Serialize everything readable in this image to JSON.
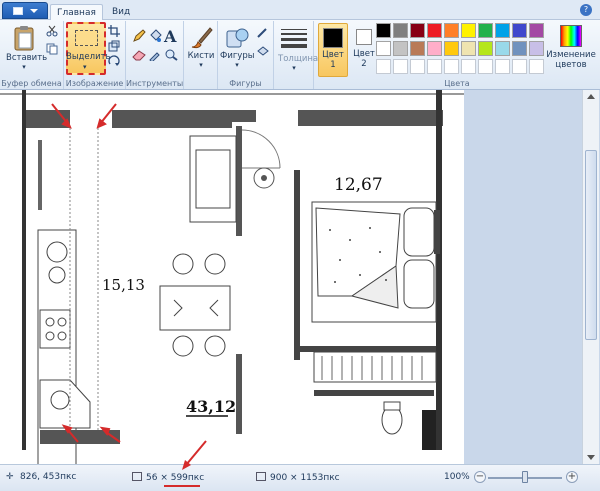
{
  "tabs": {
    "home": "Главная",
    "view": "Вид"
  },
  "groups": {
    "clipboard": {
      "label": "Буфер обмена",
      "paste": "Вставить"
    },
    "image": {
      "label": "Изображение",
      "select": "Выделить"
    },
    "tools": {
      "label": "Инструменты"
    },
    "brushes": {
      "label": "Кисти"
    },
    "shapes": {
      "label": "Фигуры",
      "shapes_btn": "Фигуры"
    },
    "size": {
      "label": "Толщина"
    },
    "colors": {
      "label": "Цвета",
      "color1": "Цвет",
      "color1_num": "1",
      "color2": "Цвет",
      "color2_num": "2",
      "edit_line1": "Изменение",
      "edit_line2": "цветов",
      "color1_value": "#000000",
      "color2_value": "#ffffff",
      "palette_row1": [
        "#000000",
        "#7f7f7f",
        "#880015",
        "#ed1c24",
        "#ff7f27",
        "#fff200",
        "#22b14c",
        "#00a2e8",
        "#3f48cc",
        "#a349a4"
      ],
      "palette_row2": [
        "#ffffff",
        "#c3c3c3",
        "#b97a57",
        "#ffaec9",
        "#ffc90e",
        "#efe4b0",
        "#b5e61d",
        "#99d9ea",
        "#7092be",
        "#c8bfe7"
      ]
    }
  },
  "floorplan": {
    "area_bedroom": "12,67",
    "area_kitchen": "15,13",
    "area_total": "43,12"
  },
  "status": {
    "cursor_pos": "826, 453пкс",
    "selection_size": "56 × 599пкс",
    "image_size": "900 × 1153пкс",
    "zoom": "100%",
    "zoom_fraction": 0.5
  },
  "colors": {
    "annotation_red": "#d52b2b",
    "ribbon_accent": "#2d64b0"
  }
}
